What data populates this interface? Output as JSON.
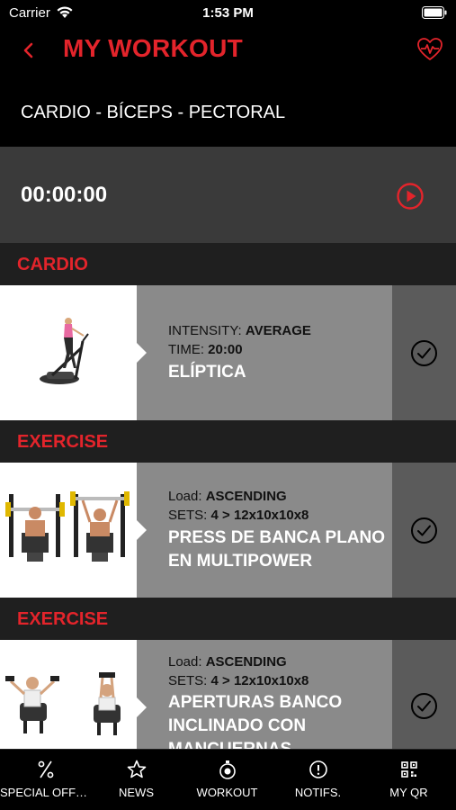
{
  "status_bar": {
    "carrier": "Carrier",
    "time": "1:53 PM"
  },
  "header": {
    "title": "MY WORKOUT"
  },
  "routine": {
    "name": "CARDIO - BÍCEPS - PECTORAL"
  },
  "timer": {
    "value": "00:00:00"
  },
  "colors": {
    "accent": "#e3242b",
    "panel": "#3a3a3a",
    "info_bg": "#8a8a8a",
    "check_bg": "#5b5b5b"
  },
  "sections": [
    {
      "title": "CARDIO",
      "exercise": {
        "line1_label": "INTENSITY: ",
        "line1_value": "AVERAGE",
        "line2_label": "TIME: ",
        "line2_value": "20:00",
        "name": "ELÍPTICA",
        "image_icon": "elliptical-machine-icon"
      }
    },
    {
      "title": "EXERCISE",
      "exercise": {
        "line1_label": "Load: ",
        "line1_value": "ASCENDING",
        "line2_label": "SETS: ",
        "line2_value": "4 > 12x10x10x8",
        "name": "PRESS DE BANCA PLANO EN MULTIPOWER",
        "image_icon": "bench-press-icon"
      }
    },
    {
      "title": "EXERCISE",
      "exercise": {
        "line1_label": "Load: ",
        "line1_value": "ASCENDING",
        "line2_label": "SETS: ",
        "line2_value": "4 > 12x10x10x8",
        "name": "APERTURAS BANCO INCLINADO CON MANCUERNAS",
        "image_icon": "dumbbell-fly-icon"
      }
    }
  ],
  "tabs": [
    {
      "label": "SPECIAL OFFE...",
      "icon": "percent-icon"
    },
    {
      "label": "NEWS",
      "icon": "star-icon"
    },
    {
      "label": "WORKOUT",
      "icon": "stopwatch-icon"
    },
    {
      "label": "NOTIFS.",
      "icon": "alert-icon"
    },
    {
      "label": "MY QR",
      "icon": "qr-code-icon"
    }
  ]
}
